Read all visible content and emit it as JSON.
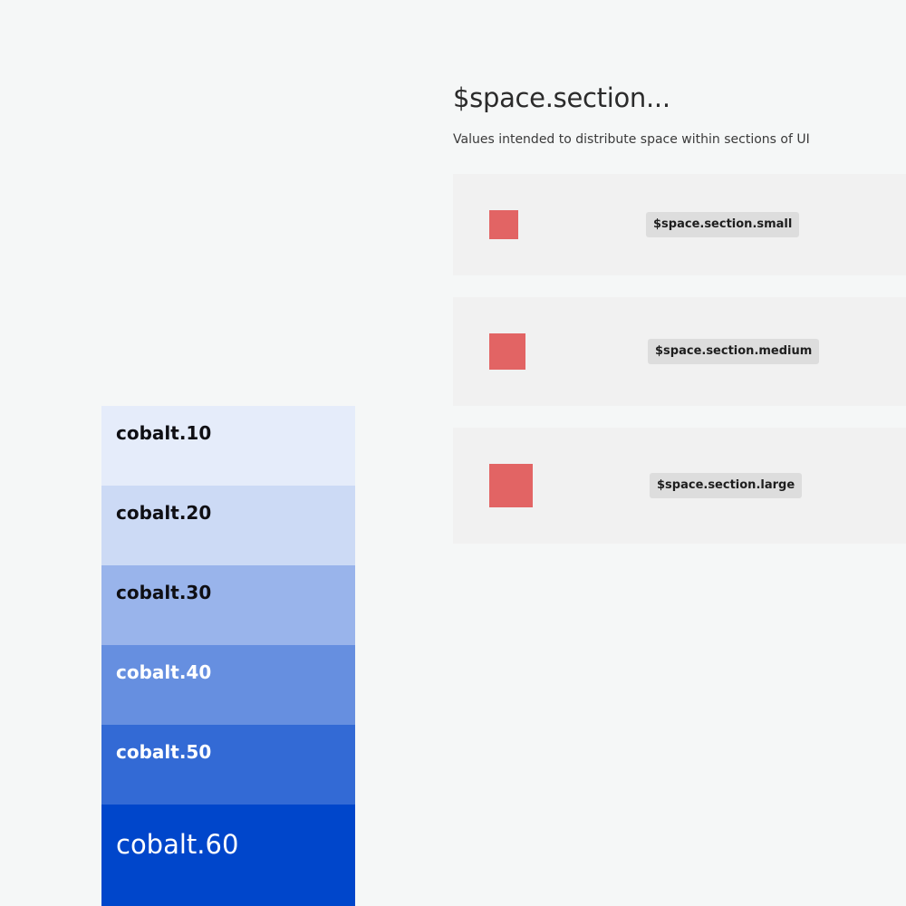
{
  "space": {
    "title": "$space.section...",
    "description": "Values intended to distribute space within sections of UI",
    "rows": [
      {
        "token": "$space.section.small"
      },
      {
        "token": "$space.section.medium"
      },
      {
        "token": "$space.section.large"
      }
    ],
    "swatch_color": "#e26464"
  },
  "palette": {
    "bands": [
      {
        "label": "cobalt.10",
        "color": "#e5ecfa",
        "text_color": "#0f0f14"
      },
      {
        "label": "cobalt.20",
        "color": "#ccdaf5",
        "text_color": "#0f0f14"
      },
      {
        "label": "cobalt.30",
        "color": "#99b4eb",
        "text_color": "#0f0f14"
      },
      {
        "label": "cobalt.40",
        "color": "#668fe0",
        "text_color": "#ffffff"
      },
      {
        "label": "cobalt.50",
        "color": "#336ad5",
        "text_color": "#ffffff"
      },
      {
        "label": "cobalt.60",
        "color": "#0046cb",
        "text_color": "#ffffff"
      }
    ]
  }
}
